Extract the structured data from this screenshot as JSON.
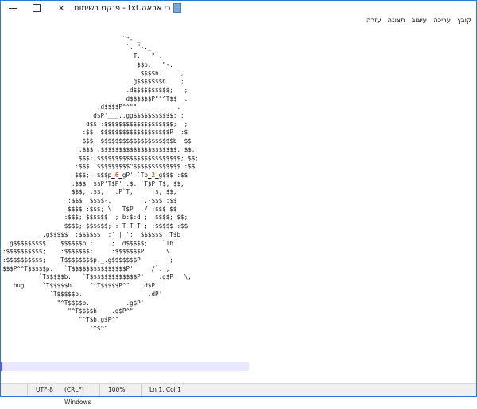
{
  "window": {
    "title": "כי אראה.txt - פנקס רשימות"
  },
  "menu": {
    "items": [
      "קובץ",
      "עריכה",
      "עיצוב",
      "תצוגה",
      "עזרה"
    ]
  },
  "editor": {
    "lines": [
      "",
      "                                 `\"-._",
      "                                  `. \"-._",
      "                                    T.   \"-.",
      "                                     $$p.   \"-.",
      "                                      $$$$b.    `,",
      "                                   .g$$$$$$$b    ;",
      "                                  .d$$$$$$$$$$;   ;",
      "                                __d$$$$$$P\"\"^T$$  :",
      "                          .d$$$$P^^\"\"___        :",
      "                         d$P'___..gg$$$$$$$$$$$; ;",
      "                       d$$ :$$$$$$$$$$$$$$$$$$$;  ;",
      "                      :$$; $$$$$$$$$$$$$$$$$$$P  :$",
      "                      $$$  $$$$$$$$$$$$$$$$$$$$b  $$",
      "                     :$$$ :$$$$$$$$$$$$$$$$$$$$$; $$;",
      "                     $$$; $$$$$$$$$$$$$$$$$$$$$$$; $$;",
      "                    :$$$  $$$$$$$$$^$$$$$$$$$$$$$ :$$",
      "                    $$$; :$$$p_6_gP' `Tp_2_g$$$ :$$",
      "                   :$$$  $$P'T$P' .$. `T$P'T$; $$;",
      "                   $$$; :$$;   :P`T;     :$; $$;",
      "                  :$$$  $$$$-.         .-$$$ :$$",
      "                  $$$$ :$$$; \\   T$P   / :$$$ $$",
      "                 :$$$; $$$$$$  ; b:$:d ;  $$$$; $$;",
      "                 $$$$; $$$$$$; : T T T ; :$$$$$ :$$",
      "           .g$$$$$  :$$$$$$  ;' | ';  $$$$$$  T$b",
      " .g$$$$$$$$$    $$$$$$b :     ;  d$$$$$;    `Tb",
      ":$$$$$$$$$$;    :$$$$$$$;     :$$$$$$$P      \\",
      ":$$$$$$$$$$;    T$$$$$$$$p._.g$$$$$$$P        ;",
      "$$$P^^T$$$$$p.   `T$$$$$$$$$$$$$$$P'    _/`. ;",
      "          `T$$$$$b.   `T$$$$$$$$$$$$$P'    .g$P   \\;",
      "   bug     `T$$$$$b.    \"^T$$$$$P^\"    d$P'",
      "             `T$$$$$b.                  .dP'",
      "               \"^T$$$$b.          .g$P'",
      "                  \"^T$$$$b    .g$P^\"",
      "                     \"^T$b.g$P^\"",
      "                        \"^$^\""
    ]
  },
  "status": {
    "encoding": "UTF-8",
    "line_ending": "(CRLF) Windows",
    "zoom": "100%",
    "position": "Ln 1, Col 1"
  }
}
